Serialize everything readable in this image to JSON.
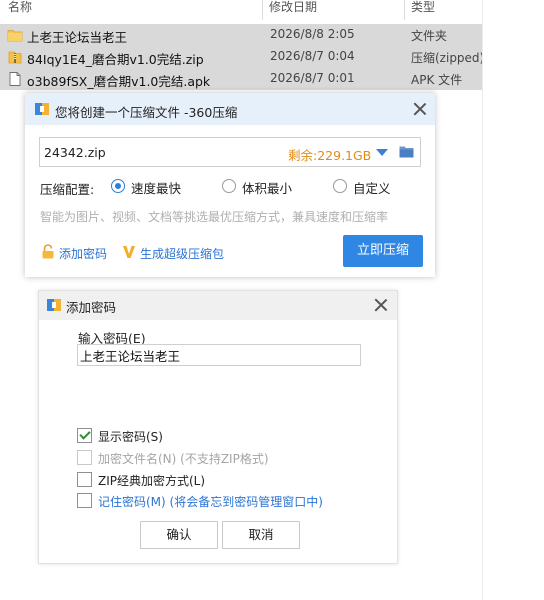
{
  "file_list": {
    "columns": {
      "name": "名称",
      "date": "修改日期",
      "type": "类型"
    },
    "rows": [
      {
        "icon": "folder-icon",
        "name": "上老王论坛当老王",
        "date": "2026/8/8 2:05",
        "type": "文件夹"
      },
      {
        "icon": "zip-file-icon",
        "name": "84Iqy1E4_磨合期v1.0完结.zip",
        "date": "2026/8/7 0:04",
        "type": "压缩(zipped)"
      },
      {
        "icon": "file-icon",
        "name": "o3b89fSX_磨合期v1.0完结.apk",
        "date": "2026/8/7 0:01",
        "type": "APK 文件"
      }
    ]
  },
  "compress_dialog": {
    "title": "您将创建一个压缩文件 -360压缩",
    "filename": "24342.zip",
    "free_space": "剩余:229.1GB",
    "config_label": "压缩配置:",
    "options": [
      {
        "label": "速度最快",
        "selected": true
      },
      {
        "label": "体积最小",
        "selected": false
      },
      {
        "label": "自定义",
        "selected": false
      }
    ],
    "hint": "智能为图片、视频、文档等挑选最优压缩方式，兼具速度和压缩率",
    "add_password": "添加密码",
    "super_compress": "生成超级压缩包",
    "start_button": "立即压缩"
  },
  "password_dialog": {
    "title": "添加密码",
    "input_label": "输入密码(E)",
    "password_value": "上老王论坛当老王",
    "checkboxes": [
      {
        "label": "显示密码(S)",
        "checked": true,
        "enabled": true,
        "style": "dark"
      },
      {
        "label": "加密文件名(N) (不支持ZIP格式)",
        "checked": false,
        "enabled": false,
        "style": "gray"
      },
      {
        "label": "ZIP经典加密方式(L)",
        "checked": false,
        "enabled": true,
        "style": "dark"
      },
      {
        "label": "记住密码(M) (将会备忘到密码管理窗口中)",
        "checked": false,
        "enabled": true,
        "style": "blue"
      }
    ],
    "ok_button": "确认",
    "cancel_button": "取消"
  },
  "colors": {
    "accent": "#2f86e3",
    "free_space": "#e38a10",
    "link": "#2b74d2",
    "selected_row": "#d9d9d9"
  }
}
